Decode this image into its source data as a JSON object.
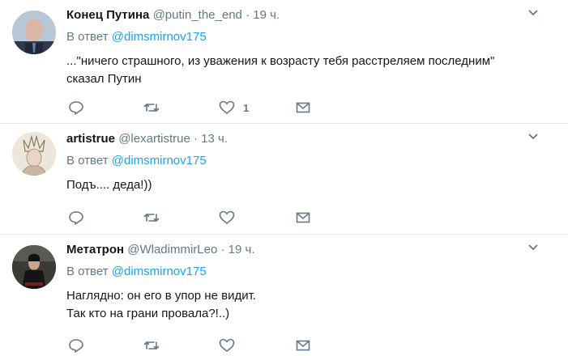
{
  "tweets": [
    {
      "name": "Конец Путина",
      "handle": "@putin_the_end",
      "dot": "·",
      "time": "19 ч.",
      "reply_prefix": "В ответ",
      "reply_to": "@dimsmirnov175",
      "text_lines": [
        "...\"ничего страшного, из уважения к возрасту тебя расстреляем последним\"",
        "сказал Путин"
      ],
      "like_count": "1",
      "avatar": "avatar-photo-man-suit"
    },
    {
      "name": "artistrue",
      "handle": "@lexartistrue",
      "dot": "·",
      "time": "13 ч.",
      "reply_prefix": "В ответ",
      "reply_to": "@dimsmirnov175",
      "text_lines": [
        "Подъ.... деда!))"
      ],
      "like_count": "",
      "avatar": "avatar-illustration-crown"
    },
    {
      "name": "Метатрон",
      "handle": "@WladimmirLeo",
      "dot": "·",
      "time": "19 ч.",
      "reply_prefix": "В ответ",
      "reply_to": "@dimsmirnov175",
      "text_lines": [
        "Наглядно: он его в упор не видит.",
        "Так кто на грани провала?!..)"
      ],
      "like_count": "",
      "avatar": "avatar-photo-dark"
    }
  ],
  "icons": {
    "reply": "reply-icon",
    "retweet": "retweet-icon",
    "like": "heart-icon",
    "dm": "envelope-icon",
    "more": "chevron-down-icon"
  },
  "colors": {
    "link": "#1da1f2",
    "muted": "#657786",
    "text": "#14171a",
    "divider": "#e6ecf0"
  }
}
